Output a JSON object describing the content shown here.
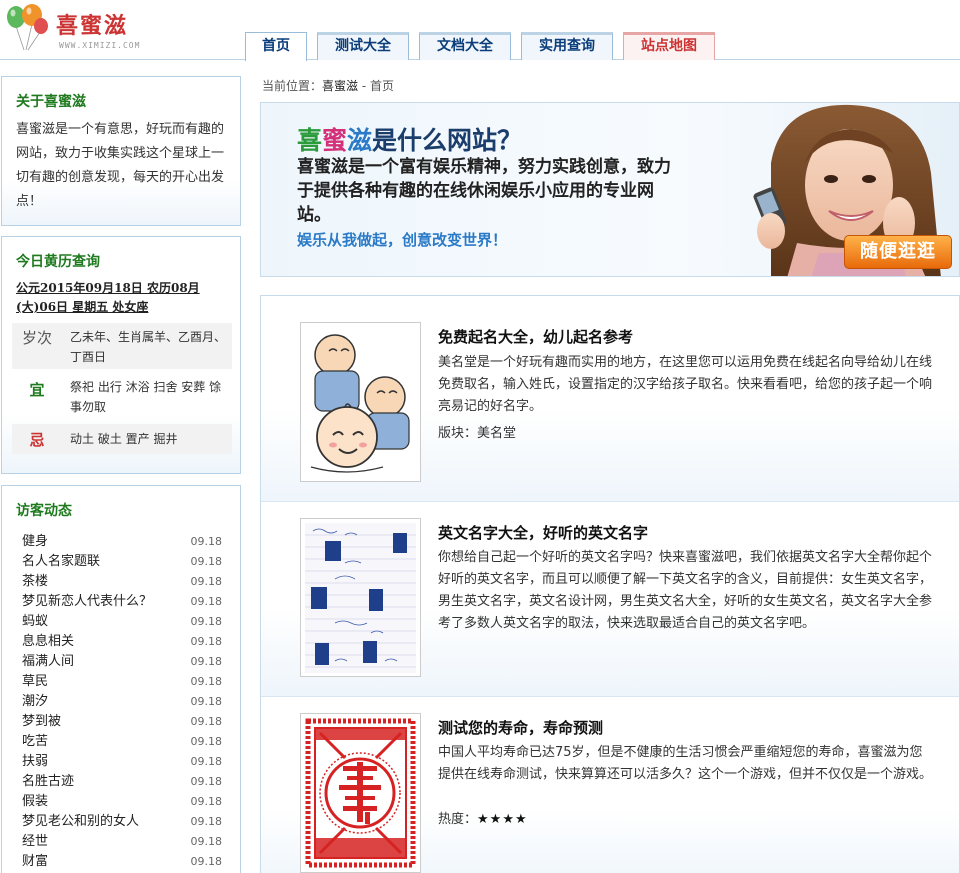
{
  "header": {
    "brand": "喜蜜滋",
    "brand_sub": "WWW.XIMIZI.COM",
    "nav": [
      {
        "label": "首页"
      },
      {
        "label": "测试大全"
      },
      {
        "label": "文档大全"
      },
      {
        "label": "实用查询"
      },
      {
        "label": "站点地图"
      }
    ]
  },
  "about": {
    "title": "关于喜蜜滋",
    "text": "喜蜜滋是一个有意思，好玩而有趣的网站，致力于收集实践这个星球上一切有趣的创意发现，每天的开心出发点！"
  },
  "calendar": {
    "title": "今日黄历查询",
    "date": "公元2015年09月18日  农历08月(大)06日 星期五 处女座",
    "sui_label": "岁次",
    "sui_value": "乙未年、生肖属羊、乙酉月、丁酉日",
    "yi_label": "宜",
    "yi_value": "祭祀 出行 沐浴 扫舍 安葬 馀事勿取",
    "ji_label": "忌",
    "ji_value": "动土 破土 置产 掘井"
  },
  "visitors": {
    "title": "访客动态",
    "items": [
      {
        "name": "健身",
        "date": "09.18"
      },
      {
        "name": "名人名家题联",
        "date": "09.18"
      },
      {
        "name": "茶楼",
        "date": "09.18"
      },
      {
        "name": "梦见新恋人代表什么？",
        "date": "09.18"
      },
      {
        "name": "蚂蚁",
        "date": "09.18"
      },
      {
        "name": "息息相关",
        "date": "09.18"
      },
      {
        "name": "福满人间",
        "date": "09.18"
      },
      {
        "name": "草民",
        "date": "09.18"
      },
      {
        "name": "潮汐",
        "date": "09.18"
      },
      {
        "name": "梦到被",
        "date": "09.18"
      },
      {
        "name": "吃苦",
        "date": "09.18"
      },
      {
        "name": "扶弱",
        "date": "09.18"
      },
      {
        "name": "名胜古迹",
        "date": "09.18"
      },
      {
        "name": "假装",
        "date": "09.18"
      },
      {
        "name": "梦见老公和别的女人",
        "date": "09.18"
      },
      {
        "name": "经世",
        "date": "09.18"
      },
      {
        "name": "财富",
        "date": "09.18"
      }
    ]
  },
  "breadcrumb": {
    "prefix": "当前位置：",
    "home": "喜蜜滋",
    "sep": " - ",
    "current": "首页"
  },
  "banner": {
    "heading_a": "喜",
    "heading_b": "蜜",
    "heading_c": "滋",
    "heading_rest": "是什么网站？",
    "para": "喜蜜滋是一个富有娱乐精神，努力实践创意，致力于提供各种有趣的在线休闲娱乐小应用的专业网站。",
    "slogan": "娱乐从我做起，创意改变世界！",
    "cta": "随便逛逛"
  },
  "articles": [
    {
      "title": "免费起名大全，幼儿起名参考",
      "desc": "美名堂是一个好玩有趣而实用的地方，在这里您可以运用免费在线起名向导给幼儿在线免费取名，输入姓氏，设置指定的汉字给孩子取名。快来看看吧，给您的孩子起一个响亮易记的好名字。",
      "meta": "版块：美名堂"
    },
    {
      "title": "英文名字大全，好听的英文名字",
      "desc": "你想给自己起一个好听的英文名字吗？快来喜蜜滋吧，我们依据英文名字大全帮你起个好听的英文名字，而且可以顺便了解一下英文名字的含义，目前提供：女生英文名字，男生英文名字，英文名设计网，男生英文名大全，好听的女生英文名，英文名字大全参考了多数人英文名字的取法，快来选取最适合自己的英文名字吧。"
    },
    {
      "title": "测试您的寿命，寿命预测",
      "desc": "中国人平均寿命已达75岁，但是不健康的生活习惯会严重缩短您的寿命，喜蜜滋为您提供在线寿命测试，快来算算还可以活多久？这个一个游戏，但并不仅仅是一个游戏。",
      "meta": "热度：",
      "stars": "★★★★"
    }
  ],
  "colors": {
    "accent_green": "#1f7a1f",
    "accent_red": "#cc3333",
    "nav_blue": "#0a3d7a",
    "border_blue": "#b9d1e5",
    "cta_orange": "#e86a0a"
  }
}
